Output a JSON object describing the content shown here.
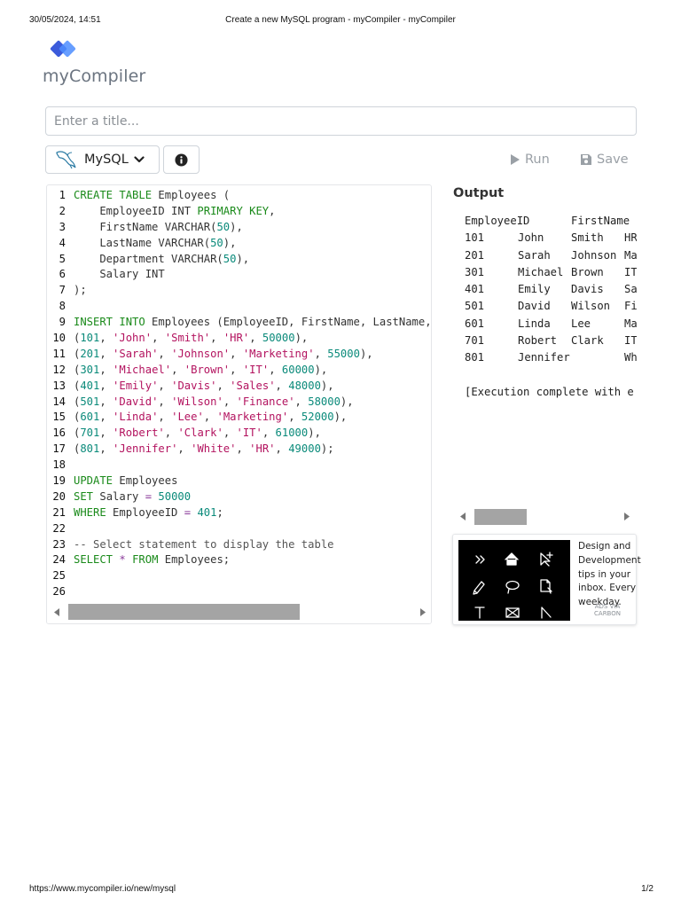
{
  "print_header": {
    "datetime": "30/05/2024, 14:51",
    "page_title": "Create a new MySQL program - myCompiler - myCompiler"
  },
  "print_footer": {
    "url": "https://www.mycompiler.io/new/mysql",
    "page": "1/2"
  },
  "logo": {
    "text": "myCompiler",
    "icon": "overlapping-diamonds-logo-icon"
  },
  "title_input": {
    "value": "",
    "placeholder": "Enter a title..."
  },
  "toolbar": {
    "language_label": "MySQL",
    "language_icon": "dolphin-icon",
    "info_icon": "info-circle-icon",
    "run_label": "Run",
    "save_label": "Save"
  },
  "editor": {
    "lines": [
      {
        "n": "1",
        "tokens": [
          [
            "kw",
            "CREATE TABLE"
          ],
          [
            "",
            " Employees ("
          ]
        ]
      },
      {
        "n": "2",
        "tokens": [
          [
            "",
            "    EmployeeID INT "
          ],
          [
            "kw",
            "PRIMARY KEY"
          ],
          [
            "",
            ","
          ]
        ]
      },
      {
        "n": "3",
        "tokens": [
          [
            "",
            "    FirstName VARCHAR("
          ],
          [
            "num",
            "50"
          ],
          [
            "",
            "),"
          ]
        ]
      },
      {
        "n": "4",
        "tokens": [
          [
            "",
            "    LastName VARCHAR("
          ],
          [
            "num",
            "50"
          ],
          [
            "",
            "),"
          ]
        ]
      },
      {
        "n": "5",
        "tokens": [
          [
            "",
            "    Department VARCHAR("
          ],
          [
            "num",
            "50"
          ],
          [
            "",
            "),"
          ]
        ]
      },
      {
        "n": "6",
        "tokens": [
          [
            "",
            "    Salary INT"
          ]
        ]
      },
      {
        "n": "7",
        "tokens": [
          [
            "",
            ");"
          ]
        ]
      },
      {
        "n": "8",
        "tokens": []
      },
      {
        "n": "9",
        "tokens": [
          [
            "kw",
            "INSERT INTO"
          ],
          [
            "",
            " Employees (EmployeeID, FirstName, LastName,"
          ]
        ]
      },
      {
        "n": "10",
        "tokens": [
          [
            "",
            "("
          ],
          [
            "num",
            "101"
          ],
          [
            "",
            ", "
          ],
          [
            "str",
            "'John'"
          ],
          [
            "",
            ", "
          ],
          [
            "str",
            "'Smith'"
          ],
          [
            "",
            ", "
          ],
          [
            "str",
            "'HR'"
          ],
          [
            "",
            ", "
          ],
          [
            "num",
            "50000"
          ],
          [
            "",
            "),"
          ]
        ]
      },
      {
        "n": "11",
        "tokens": [
          [
            "",
            "("
          ],
          [
            "num",
            "201"
          ],
          [
            "",
            ", "
          ],
          [
            "str",
            "'Sarah'"
          ],
          [
            "",
            ", "
          ],
          [
            "str",
            "'Johnson'"
          ],
          [
            "",
            ", "
          ],
          [
            "str",
            "'Marketing'"
          ],
          [
            "",
            ", "
          ],
          [
            "num",
            "55000"
          ],
          [
            "",
            "),"
          ]
        ]
      },
      {
        "n": "12",
        "tokens": [
          [
            "",
            "("
          ],
          [
            "num",
            "301"
          ],
          [
            "",
            ", "
          ],
          [
            "str",
            "'Michael'"
          ],
          [
            "",
            ", "
          ],
          [
            "str",
            "'Brown'"
          ],
          [
            "",
            ", "
          ],
          [
            "str",
            "'IT'"
          ],
          [
            "",
            ", "
          ],
          [
            "num",
            "60000"
          ],
          [
            "",
            "),"
          ]
        ]
      },
      {
        "n": "13",
        "tokens": [
          [
            "",
            "("
          ],
          [
            "num",
            "401"
          ],
          [
            "",
            ", "
          ],
          [
            "str",
            "'Emily'"
          ],
          [
            "",
            ", "
          ],
          [
            "str",
            "'Davis'"
          ],
          [
            "",
            ", "
          ],
          [
            "str",
            "'Sales'"
          ],
          [
            "",
            ", "
          ],
          [
            "num",
            "48000"
          ],
          [
            "",
            "),"
          ]
        ]
      },
      {
        "n": "14",
        "tokens": [
          [
            "",
            "("
          ],
          [
            "num",
            "501"
          ],
          [
            "",
            ", "
          ],
          [
            "str",
            "'David'"
          ],
          [
            "",
            ", "
          ],
          [
            "str",
            "'Wilson'"
          ],
          [
            "",
            ", "
          ],
          [
            "str",
            "'Finance'"
          ],
          [
            "",
            ", "
          ],
          [
            "num",
            "58000"
          ],
          [
            "",
            "),"
          ]
        ]
      },
      {
        "n": "15",
        "tokens": [
          [
            "",
            "("
          ],
          [
            "num",
            "601"
          ],
          [
            "",
            ", "
          ],
          [
            "str",
            "'Linda'"
          ],
          [
            "",
            ", "
          ],
          [
            "str",
            "'Lee'"
          ],
          [
            "",
            ", "
          ],
          [
            "str",
            "'Marketing'"
          ],
          [
            "",
            ", "
          ],
          [
            "num",
            "52000"
          ],
          [
            "",
            "),"
          ]
        ]
      },
      {
        "n": "16",
        "tokens": [
          [
            "",
            "("
          ],
          [
            "num",
            "701"
          ],
          [
            "",
            ", "
          ],
          [
            "str",
            "'Robert'"
          ],
          [
            "",
            ", "
          ],
          [
            "str",
            "'Clark'"
          ],
          [
            "",
            ", "
          ],
          [
            "str",
            "'IT'"
          ],
          [
            "",
            ", "
          ],
          [
            "num",
            "61000"
          ],
          [
            "",
            "),"
          ]
        ]
      },
      {
        "n": "17",
        "tokens": [
          [
            "",
            "("
          ],
          [
            "num",
            "801"
          ],
          [
            "",
            ", "
          ],
          [
            "str",
            "'Jennifer'"
          ],
          [
            "",
            ", "
          ],
          [
            "str",
            "'White'"
          ],
          [
            "",
            ", "
          ],
          [
            "str",
            "'HR'"
          ],
          [
            "",
            ", "
          ],
          [
            "num",
            "49000"
          ],
          [
            "",
            ");"
          ]
        ]
      },
      {
        "n": "18",
        "tokens": []
      },
      {
        "n": "19",
        "tokens": [
          [
            "kw",
            "UPDATE"
          ],
          [
            "",
            " Employees"
          ]
        ]
      },
      {
        "n": "20",
        "tokens": [
          [
            "kw",
            "SET"
          ],
          [
            "",
            " Salary "
          ],
          [
            "op",
            "="
          ],
          [
            "",
            " "
          ],
          [
            "num",
            "50000"
          ]
        ]
      },
      {
        "n": "21",
        "tokens": [
          [
            "kw",
            "WHERE"
          ],
          [
            "",
            " EmployeeID "
          ],
          [
            "op",
            "="
          ],
          [
            "",
            " "
          ],
          [
            "num",
            "401"
          ],
          [
            "",
            ";"
          ]
        ]
      },
      {
        "n": "22",
        "tokens": []
      },
      {
        "n": "23",
        "tokens": [
          [
            "cmt",
            "-- Select statement to display the table"
          ]
        ]
      },
      {
        "n": "24",
        "tokens": [
          [
            "kw",
            "SELECT"
          ],
          [
            "",
            " "
          ],
          [
            "op",
            "*"
          ],
          [
            "",
            " "
          ],
          [
            "kw",
            "FROM"
          ],
          [
            "",
            " Employees;"
          ]
        ]
      },
      {
        "n": "25",
        "tokens": []
      },
      {
        "n": "26",
        "tokens": []
      }
    ]
  },
  "output": {
    "title": "Output",
    "header": [
      "EmployeeID",
      "FirstName"
    ],
    "rows": [
      [
        "101",
        "John",
        "Smith",
        "HR"
      ],
      [
        "201",
        "Sarah",
        "Johnson",
        "Ma"
      ],
      [
        "301",
        "Michael",
        "Brown",
        "IT"
      ],
      [
        "401",
        "Emily",
        "Davis",
        "Sa"
      ],
      [
        "501",
        "David",
        "Wilson",
        "Fi"
      ],
      [
        "601",
        "Linda",
        "Lee",
        "Ma"
      ],
      [
        "701",
        "Robert",
        "Clark",
        "IT"
      ],
      [
        "801",
        "Jennifer",
        "",
        "Wh"
      ]
    ],
    "status": "[Execution complete with e"
  },
  "ad": {
    "text": "Design and Development tips in your inbox. Every weekday.",
    "via_line1": "ADS VIA",
    "via_line2": "CARBON"
  }
}
